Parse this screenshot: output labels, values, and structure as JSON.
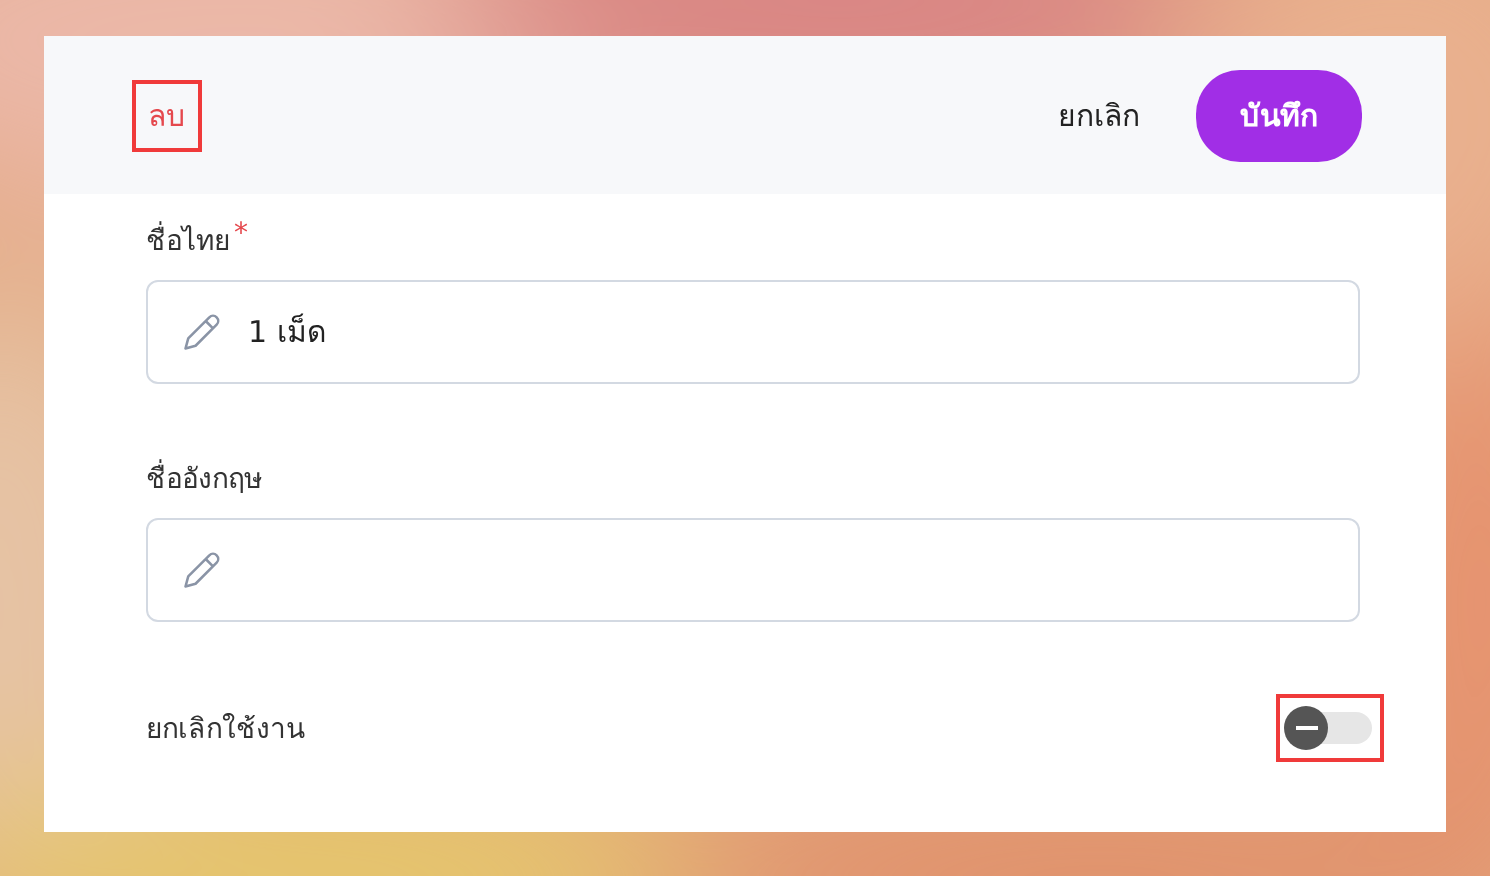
{
  "header": {
    "delete_button": {
      "label": "ลบ",
      "highlighted": true
    },
    "cancel_button": {
      "label": "ยกเลิก"
    },
    "save_button": {
      "label": "บันทึก"
    }
  },
  "fields": [
    {
      "label": "ชื่อไทย",
      "required_mark": "*",
      "value": "1 เม็ด"
    },
    {
      "label": "ชื่ออังกฤษ"
    }
  ],
  "deactivate": {
    "label": "ยกเลิกใช้งาน",
    "on": false,
    "annotation_frame": true
  }
}
